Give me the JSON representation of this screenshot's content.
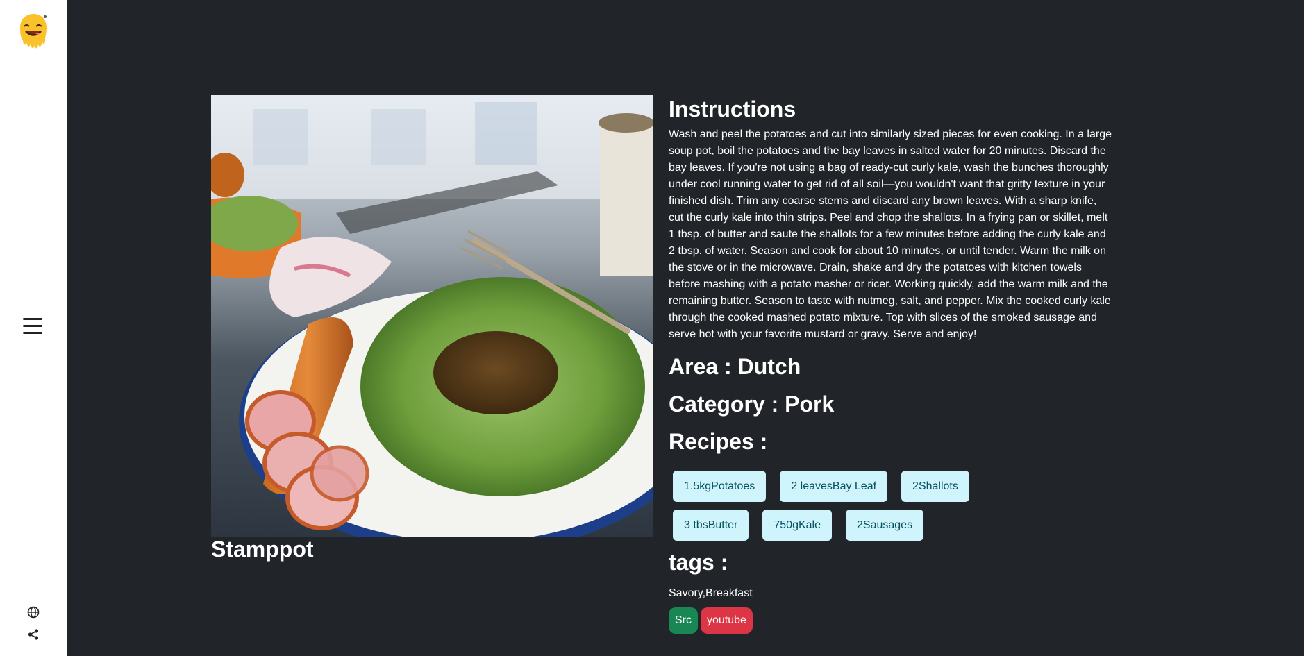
{
  "sidebar": {
    "logo_icon": "smiley-face-logo",
    "menu_icon": "hamburger-menu-icon",
    "globe_icon": "globe-icon",
    "share_icon": "share-icon"
  },
  "meal": {
    "name": "Stamppot",
    "instructions_heading": "Instructions",
    "instructions": "Wash and peel the potatoes and cut into similarly sized pieces for even cooking. In a large soup pot, boil the potatoes and the bay leaves in salted water for 20 minutes. Discard the bay leaves. If you're not using a bag of ready-cut curly kale, wash the bunches thoroughly under cool running water to get rid of all soil—you wouldn't want that gritty texture in your finished dish. Trim any coarse stems and discard any brown leaves. With a sharp knife, cut the curly kale into thin strips. Peel and chop the shallots. In a frying pan or skillet, melt 1 tbsp. of butter and saute the shallots for a few minutes before adding the curly kale and 2 tbsp. of water. Season and cook for about 10 minutes, or until tender. Warm the milk on the stove or in the microwave. Drain, shake and dry the potatoes with kitchen towels before mashing with a potato masher or ricer. Working quickly, add the warm milk and the remaining butter. Season to taste with nutmeg, salt, and pepper. Mix the cooked curly kale through the cooked mashed potato mixture. Top with slices of the smoked sausage and serve hot with your favorite mustard or gravy. Serve and enjoy!",
    "area": "Area : Dutch",
    "category": "Category : Pork",
    "recipes_heading": "Recipes :",
    "ingredients": [
      "1.5kgPotatoes",
      "2 leavesBay Leaf",
      "2Shallots",
      "3 tbsButter",
      "750gKale",
      "2Sausages"
    ],
    "tags_heading": "tags :",
    "tags": "Savory,Breakfast",
    "src_label": "Src",
    "youtube_label": "youtube"
  },
  "colors": {
    "background": "#212529",
    "ingredient_bg": "#cff4fc",
    "ingredient_text": "#055160",
    "src_button": "#198754",
    "youtube_button": "#dc3545"
  }
}
